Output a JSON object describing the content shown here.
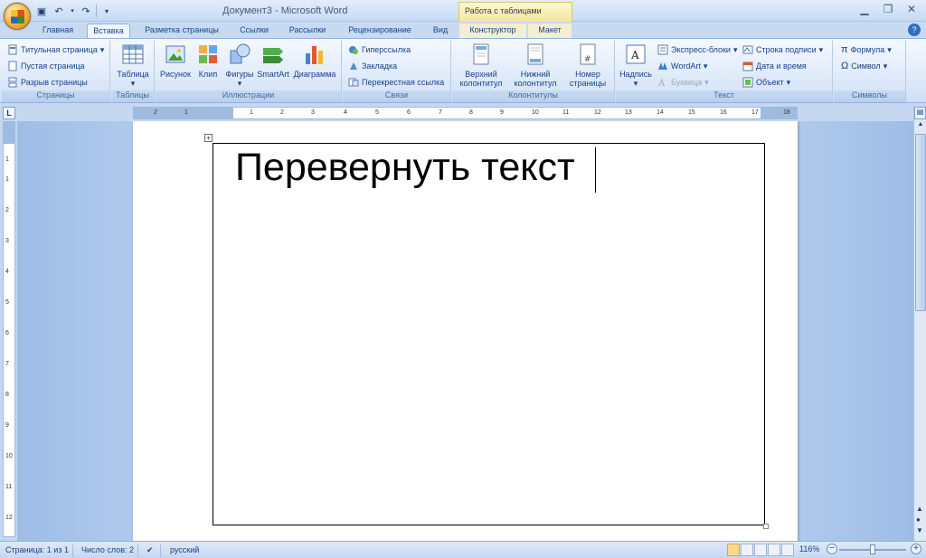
{
  "window": {
    "title": "Документ3 - Microsoft Word",
    "context_header": "Работа с таблицами"
  },
  "tabs": [
    {
      "label": "Главная"
    },
    {
      "label": "Вставка"
    },
    {
      "label": "Разметка страницы"
    },
    {
      "label": "Ссылки"
    },
    {
      "label": "Рассылки"
    },
    {
      "label": "Рецензирование"
    },
    {
      "label": "Вид"
    },
    {
      "label": "Конструктор"
    },
    {
      "label": "Макет"
    }
  ],
  "active_tab": "Вставка",
  "ribbon": {
    "pages": {
      "label": "Страницы",
      "title_page": "Титульная страница",
      "blank_page": "Пустая страница",
      "page_break": "Разрыв страницы"
    },
    "tables": {
      "label": "Таблицы",
      "table": "Таблица"
    },
    "illustrations": {
      "label": "Иллюстрации",
      "picture": "Рисунок",
      "clip": "Клип",
      "shapes": "Фигуры",
      "smartart": "SmartArt",
      "chart": "Диаграмма"
    },
    "links": {
      "label": "Связи",
      "hyperlink": "Гиперссылка",
      "bookmark": "Закладка",
      "cross_ref": "Перекрестная ссылка"
    },
    "headers_footers": {
      "label": "Колонтитулы",
      "header_l1": "Верхний",
      "header_l2": "колонтитул",
      "footer_l1": "Нижний",
      "footer_l2": "колонтитул",
      "pagenum_l1": "Номер",
      "pagenum_l2": "страницы"
    },
    "text": {
      "label": "Текст",
      "textbox": "Надпись",
      "quickparts": "Экспресс-блоки",
      "wordart": "WordArt",
      "dropcap": "Буквица",
      "signature": "Строка подписи",
      "datetime": "Дата и время",
      "object": "Объект"
    },
    "symbols": {
      "label": "Символы",
      "equation": "Формула",
      "symbol": "Символ"
    }
  },
  "ruler": {
    "h_ticks": [
      "2",
      "1",
      "1",
      "2",
      "3",
      "4",
      "5",
      "6",
      "7",
      "8",
      "9",
      "10",
      "11",
      "12",
      "13",
      "14",
      "15",
      "16",
      "17",
      "18"
    ],
    "v_ticks": [
      "1",
      "1",
      "2",
      "3",
      "4",
      "5",
      "6",
      "7",
      "8",
      "9",
      "10",
      "11",
      "12"
    ]
  },
  "document": {
    "text": "Перевернуть текст"
  },
  "statusbar": {
    "page": "Страница: 1 из 1",
    "words": "Число слов: 2",
    "language": "русский",
    "zoom": "116%"
  },
  "colors": {
    "accent": "#15428b",
    "ribbon_bg": "#dfeaf9",
    "context_tab": "#f4e79c"
  }
}
